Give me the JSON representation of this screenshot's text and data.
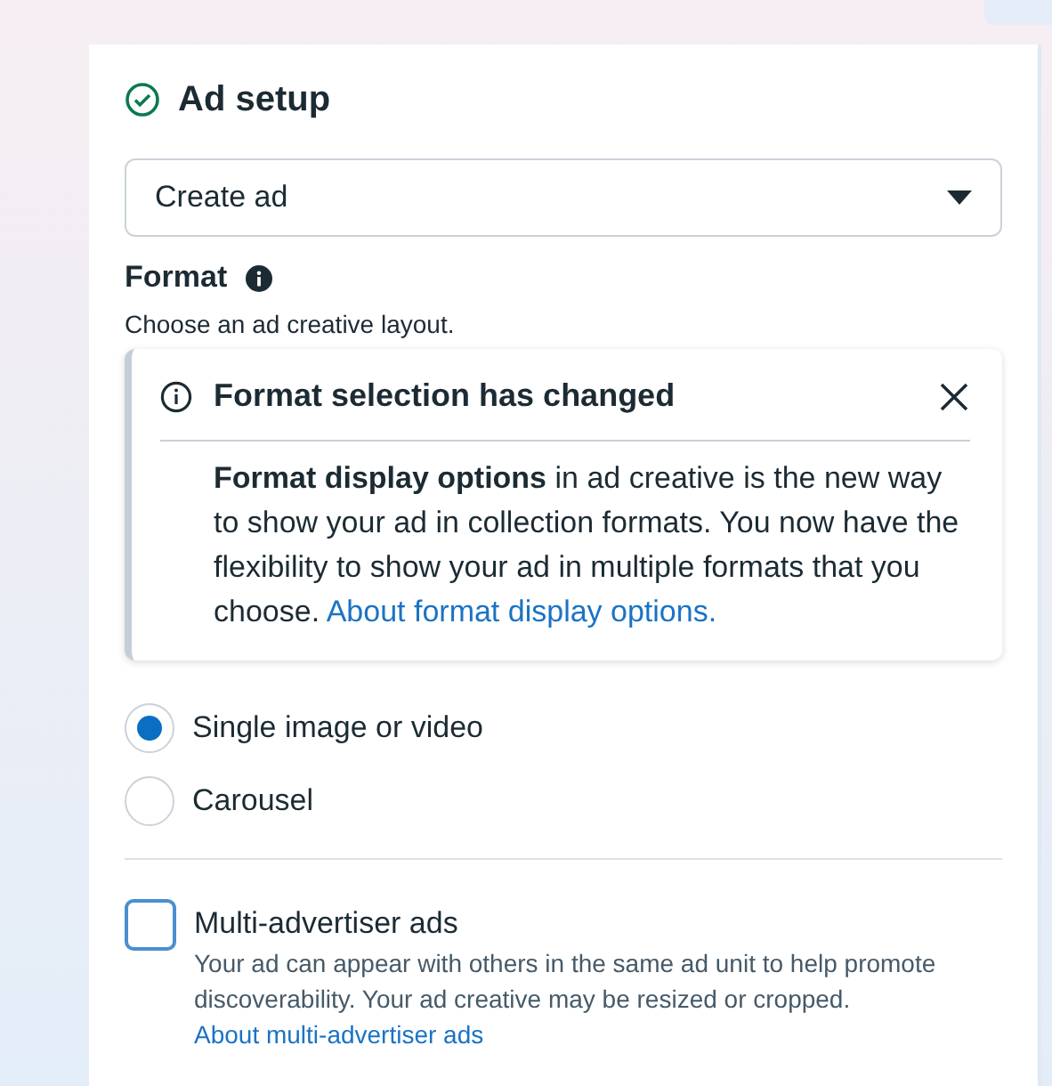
{
  "section": {
    "title": "Ad setup",
    "complete": true
  },
  "dropdown": {
    "value": "Create ad"
  },
  "format": {
    "label": "Format",
    "hint": "Choose an ad creative layout."
  },
  "notice": {
    "title": "Format selection has changed",
    "body_bold": "Format display options",
    "body": " in ad creative is the new way to show your ad in collection formats. You now have the flexibility to show your ad in multiple formats that you choose. ",
    "link": "About format display options."
  },
  "options": [
    {
      "label": "Single image or video",
      "selected": true
    },
    {
      "label": "Carousel",
      "selected": false
    }
  ],
  "multi_advertiser": {
    "label": "Multi-advertiser ads",
    "checked": false,
    "description": "Your ad can appear with others in the same ad unit to help promote discoverability. Your ad creative may be resized or cropped. ",
    "link": "About multi-advertiser ads"
  }
}
